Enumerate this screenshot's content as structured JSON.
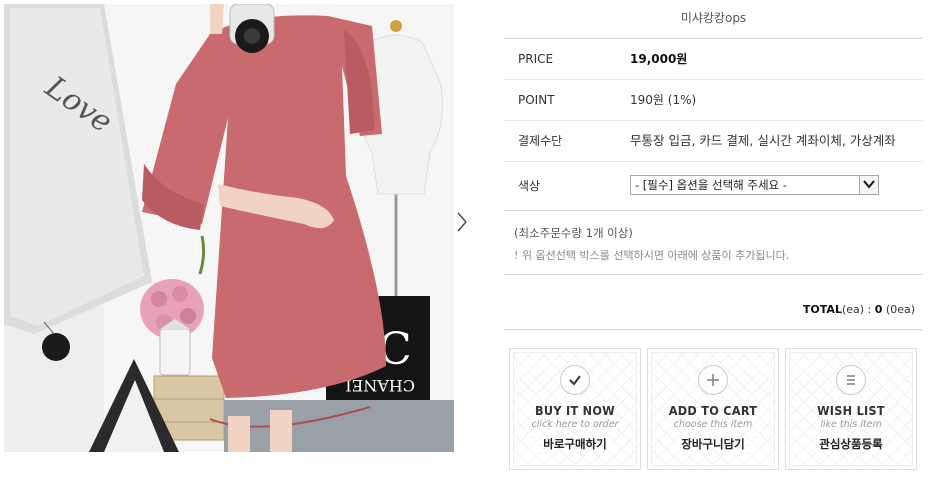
{
  "product": {
    "name": "미샤캉캉ops"
  },
  "details": {
    "price_label": "PRICE",
    "price_value": "19,000원",
    "point_label": "POINT",
    "point_value": "190원 (1%)",
    "payment_label": "결제수단",
    "payment_value": "무통장 입금, 카드 결제, 실시간 계좌이체, 가상계좌",
    "color_label": "색상",
    "color_select_value": "- [필수] 옵션을 선택해 주세요 -"
  },
  "notes": {
    "min_order": "(최소주문수량 1개 이상)",
    "hint": "! 위 옵션선택 박스를 선택하시면 아래에 상품이 추가됩니다."
  },
  "total": {
    "label": "TOTAL",
    "unit_paren": "(ea)",
    "separator": " : ",
    "amount": "0",
    "count": "(0ea)"
  },
  "buttons": {
    "buy": {
      "title": "BUY IT NOW",
      "subtitle": "click here to order",
      "korean": "바로구매하기",
      "icon": "check-icon"
    },
    "cart": {
      "title": "ADD TO CART",
      "subtitle": "choose this item",
      "korean": "장바구니담기",
      "icon": "plus-icon"
    },
    "wish": {
      "title": "WISH LIST",
      "subtitle": "like this item",
      "korean": "관심상품등록",
      "icon": "list-icon"
    }
  },
  "photo": {
    "brand_text": "CHANEL",
    "logo_text": "CC",
    "note_script": "Love"
  },
  "colors": {
    "dress": "#c86a6e",
    "accent_dark": "#222222",
    "muted": "#8a8a8a"
  }
}
